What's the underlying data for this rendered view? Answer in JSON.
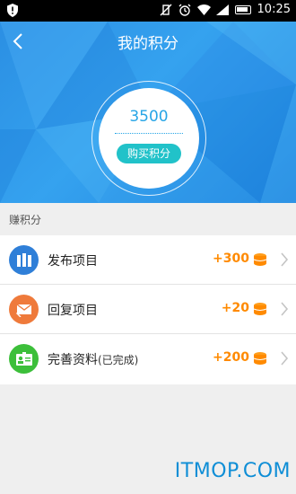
{
  "status_bar": {
    "time": "10:25"
  },
  "header": {
    "title": "我的积分",
    "points": "3500",
    "buy_label": "购买积分"
  },
  "section_label": "赚积分",
  "rows": [
    {
      "label": "发布项目",
      "suffix": "",
      "points": "+300",
      "icon": "briefcase-icon",
      "color": "#2f7fd8"
    },
    {
      "label": "回复项目",
      "suffix": "",
      "points": "+20",
      "icon": "mail-reply-icon",
      "color": "#ef7a3b"
    },
    {
      "label": "完善资料",
      "suffix": "(已完成)",
      "points": "+200",
      "icon": "id-card-icon",
      "color": "#3cbf3a"
    }
  ],
  "watermark": "ITMOP.COM"
}
